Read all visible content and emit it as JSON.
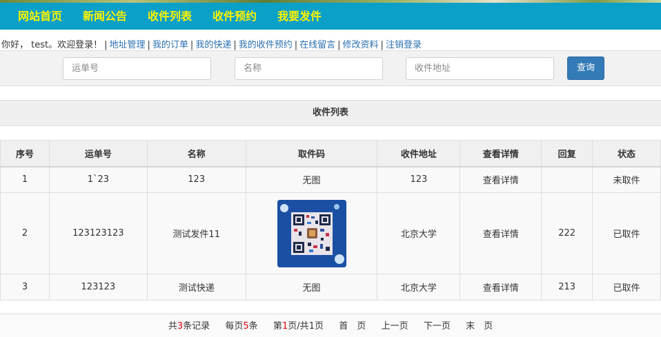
{
  "nav": {
    "items": [
      "网站首页",
      "新闻公告",
      "收件列表",
      "收件预约",
      "我要发件"
    ]
  },
  "userbar": {
    "greeting": "你好， test。欢迎登录！",
    "links": [
      "地址管理",
      "我的订单",
      "我的快递",
      "我的收件预约",
      "在线留言",
      "修改资料",
      "注销登录"
    ]
  },
  "search": {
    "waybill_placeholder": "运单号",
    "name_placeholder": "名称",
    "address_placeholder": "收件地址",
    "button_label": "查询"
  },
  "section_title": "收件列表",
  "table": {
    "headers": [
      "序号",
      "运单号",
      "名称",
      "取件码",
      "收件地址",
      "查看详情",
      "回复",
      "状态"
    ],
    "rows": [
      {
        "index": "1",
        "waybill": "1`23",
        "name": "123",
        "code": "无图",
        "address": "123",
        "detail": "查看详情",
        "reply": "",
        "status": "未取件"
      },
      {
        "index": "2",
        "waybill": "123123123",
        "name": "测试发件11",
        "code": "",
        "address": "北京大学",
        "detail": "查看详情",
        "reply": "222",
        "status": "已取件"
      },
      {
        "index": "3",
        "waybill": "123123",
        "name": "测试快递",
        "code": "无图",
        "address": "北京大学",
        "detail": "查看详情",
        "reply": "213",
        "status": "已取件"
      }
    ]
  },
  "pager": {
    "total_prefix": "共",
    "total": "3",
    "total_suffix": "条记录",
    "per_prefix": "每页",
    "per": "5",
    "per_suffix": "条",
    "page_prefix": "第",
    "page": "1",
    "page_mid": "页/共",
    "pages": "1",
    "page_suffix": "页",
    "first": "首　页",
    "prev": "上一页",
    "next": "下一页",
    "last": "末　页"
  },
  "colors": {
    "nav_bg": "#0aa0c8",
    "nav_text": "#fff200",
    "link": "#2a6fb0",
    "button": "#337ab7",
    "pager_highlight": "#e00000"
  }
}
